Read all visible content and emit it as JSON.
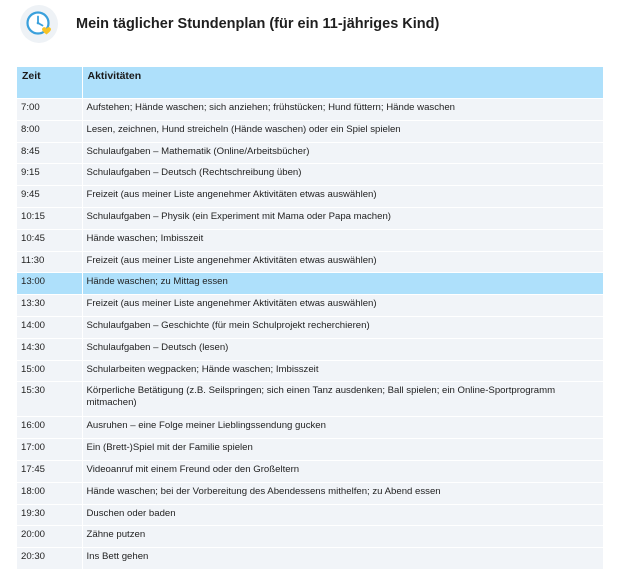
{
  "document": {
    "title": "Mein täglicher Stundenplan (für ein 11-jähriges Kind)",
    "logo_icon": "clock-heart-icon",
    "accent_color": "#aee0fb",
    "row_color": "#f1f4f8"
  },
  "table": {
    "headers": {
      "time": "Zeit",
      "activity": "Aktivitäten"
    },
    "rows": [
      {
        "time": "7:00",
        "activity": "Aufstehen; Hände waschen; sich anziehen; frühstücken; Hund füttern; Hände waschen"
      },
      {
        "time": "8:00",
        "activity": "Lesen, zeichnen, Hund streicheln (Hände waschen) oder ein Spiel spielen"
      },
      {
        "time": "8:45",
        "activity": "Schulaufgaben – Mathematik (Online/Arbeitsbücher)"
      },
      {
        "time": "9:15",
        "activity": "Schulaufgaben – Deutsch (Rechtschreibung üben)"
      },
      {
        "time": "9:45",
        "activity": "Freizeit (aus meiner Liste angenehmer Aktivitäten etwas auswählen)"
      },
      {
        "time": "10:15",
        "activity": "Schulaufgaben – Physik (ein Experiment mit Mama oder Papa machen)"
      },
      {
        "time": "10:45",
        "activity": "Hände waschen; Imbisszeit"
      },
      {
        "time": "11:30",
        "activity": "Freizeit (aus meiner Liste angenehmer Aktivitäten etwas auswählen)"
      },
      {
        "time": "13:00",
        "activity": "Hände waschen; zu Mittag essen",
        "highlight": true
      },
      {
        "time": "13:30",
        "activity": "Freizeit (aus meiner Liste angenehmer Aktivitäten etwas auswählen)"
      },
      {
        "time": "14:00",
        "activity": "Schulaufgaben – Geschichte (für mein Schulprojekt recherchieren)"
      },
      {
        "time": "14:30",
        "activity": "Schulaufgaben – Deutsch (lesen)"
      },
      {
        "time": "15:00",
        "activity": "Schularbeiten wegpacken; Hände waschen; Imbisszeit"
      },
      {
        "time": "15:30",
        "activity": "Körperliche Betätigung (z.B. Seilspringen; sich einen Tanz ausdenken; Ball spielen; ein Online-Sportprogramm mitmachen)"
      },
      {
        "time": "16:00",
        "activity": "Ausruhen – eine Folge meiner Lieblingssendung gucken"
      },
      {
        "time": "17:00",
        "activity": "Ein (Brett-)Spiel mit der Familie spielen"
      },
      {
        "time": "17:45",
        "activity": "Videoanruf mit einem Freund oder den Großeltern"
      },
      {
        "time": "18:00",
        "activity": "Hände waschen; bei der Vorbereitung des Abendessens mithelfen; zu Abend essen"
      },
      {
        "time": "19:30",
        "activity": "Duschen oder baden"
      },
      {
        "time": "20:00",
        "activity": "Zähne putzen"
      },
      {
        "time": "20:30",
        "activity": "Ins Bett gehen"
      }
    ]
  }
}
